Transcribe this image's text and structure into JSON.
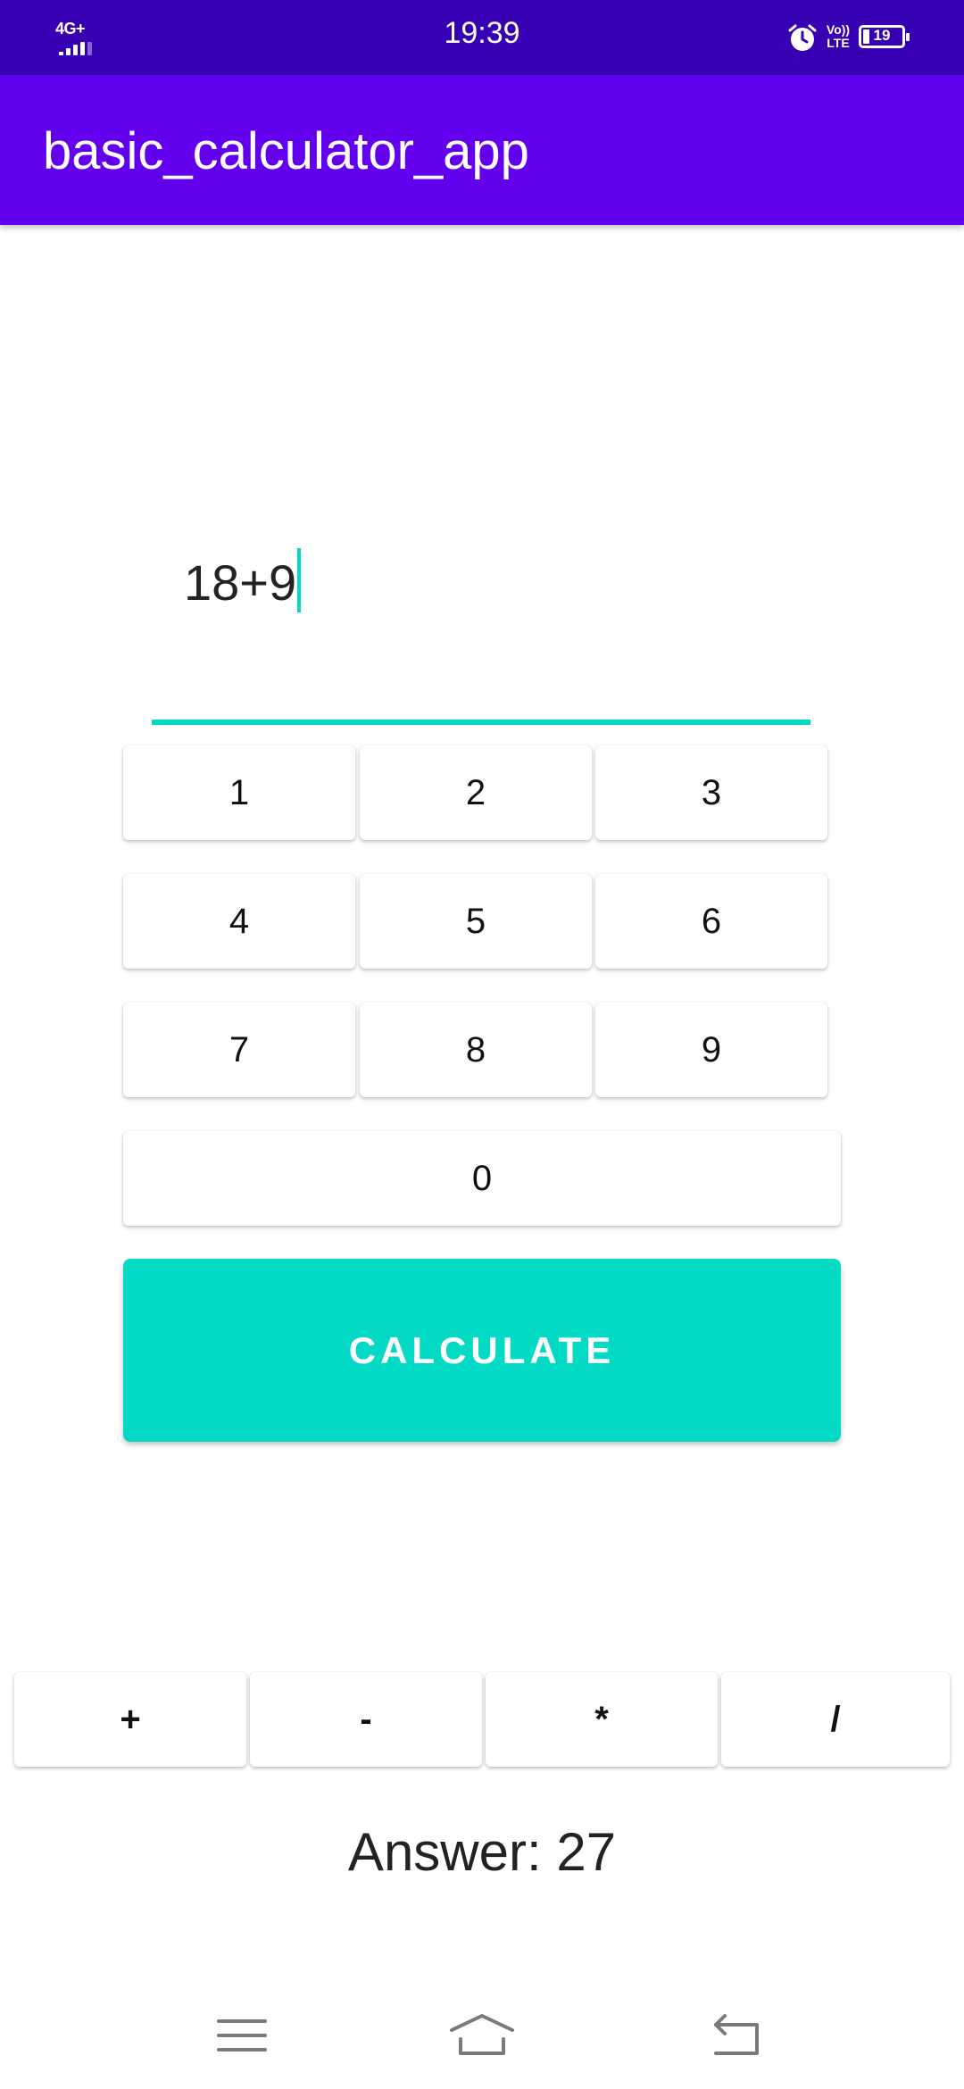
{
  "status_bar": {
    "network": "4G+",
    "time": "19:39",
    "volte": "Vo)) LTE",
    "battery": "19"
  },
  "app_bar": {
    "title": "basic_calculator_app"
  },
  "expression": {
    "value": "18+9"
  },
  "keypad": {
    "digits": [
      "1",
      "2",
      "3",
      "4",
      "5",
      "6",
      "7",
      "8",
      "9",
      "0"
    ]
  },
  "calculate_button": {
    "label": "CALCULATE"
  },
  "operators": [
    "+",
    "-",
    "*",
    "/"
  ],
  "answer": {
    "text": "Answer: 27"
  },
  "nav_bar": {
    "icons": [
      "menu-icon",
      "home-icon",
      "back-icon"
    ]
  },
  "colors": {
    "status_bar": "#3700b3",
    "app_bar": "#6200ee",
    "accent": "#03dac5"
  }
}
